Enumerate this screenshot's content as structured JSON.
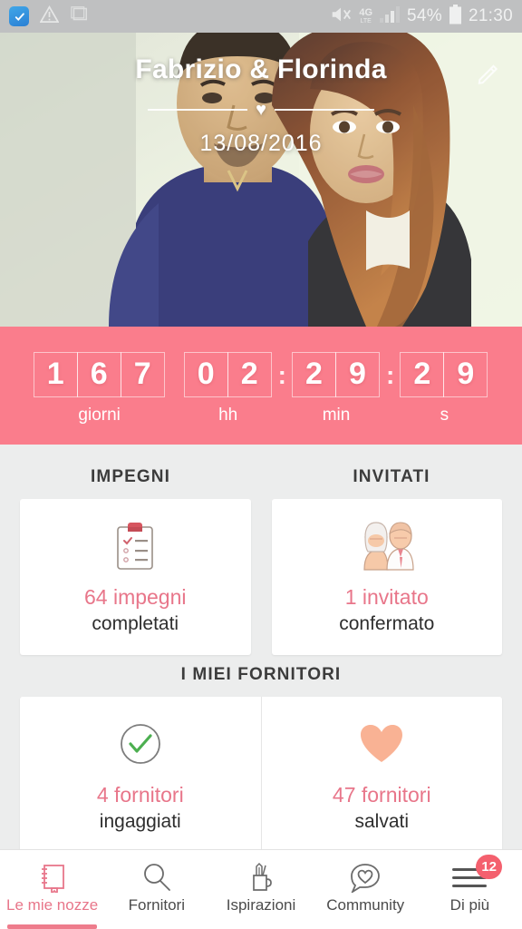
{
  "statusbar": {
    "left_icons": [
      "app-notification-icon",
      "warning-triangle-icon",
      "screenshot-icon"
    ],
    "right_icons": [
      "mute-vibrate-icon",
      "signal-bars-icon"
    ],
    "network": "4G",
    "network_sub": "LTE",
    "battery": "54%",
    "time": "21:30"
  },
  "hero": {
    "couple_names": "Fabrizio & Florinda",
    "wedding_date": "13/08/2016",
    "heart": "♥",
    "edit_icon": "pencil-edit-icon"
  },
  "countdown": {
    "days": [
      "1",
      "6",
      "7"
    ],
    "days_label": "giorni",
    "hours": [
      "0",
      "2"
    ],
    "hours_label": "hh",
    "minutes": [
      "2",
      "9"
    ],
    "minutes_label": "min",
    "seconds": [
      "2",
      "9"
    ],
    "seconds_label": "s",
    "separator": ":",
    "band_color": "#fa7d8c"
  },
  "sections": {
    "impegni_title": "IMPEGNI",
    "invitati_title": "INVITATI",
    "fornitori_title": "I MIEI FORNITORI"
  },
  "cards": {
    "impegni": {
      "icon": "clipboard-checklist-icon",
      "value": "64 impegni",
      "sub": "completati"
    },
    "invitati": {
      "icon": "bride-and-groom-icon",
      "value": "1 invitato",
      "sub": "confermato"
    },
    "fornitori_ingaggiati": {
      "icon": "green-check-circle-icon",
      "value": "4 fornitori",
      "sub": "ingaggiati"
    },
    "fornitori_salvati": {
      "icon": "heart-icon",
      "value": "47 fornitori",
      "sub": "salvati"
    },
    "accent_color": "#e8768a"
  },
  "bottomnav": {
    "items": [
      {
        "label": "Le mie nozze",
        "icon": "notebook-icon",
        "active": true
      },
      {
        "label": "Fornitori",
        "icon": "search-icon",
        "active": false
      },
      {
        "label": "Ispirazioni",
        "icon": "pencil-cup-icon",
        "active": false
      },
      {
        "label": "Community",
        "icon": "speech-bubble-heart-icon",
        "active": false
      },
      {
        "label": "Di più",
        "icon": "hamburger-menu-icon",
        "active": false
      }
    ],
    "badge": "12"
  }
}
